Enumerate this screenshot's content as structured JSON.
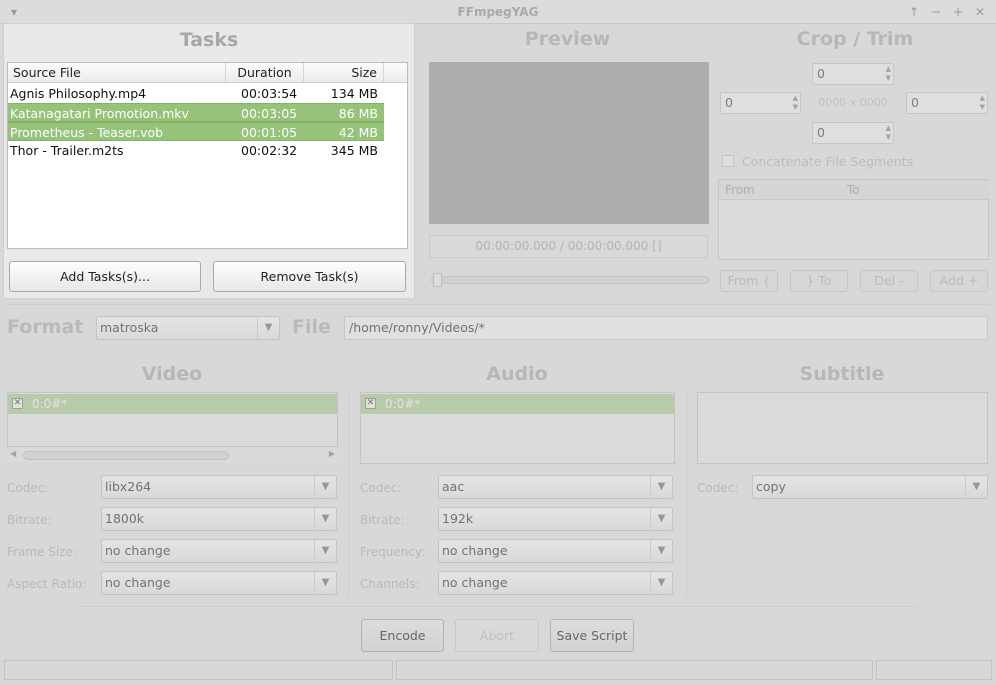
{
  "window": {
    "title": "FFmpegYAG"
  },
  "tasks": {
    "heading": "Tasks",
    "columns": [
      "Source File",
      "Duration",
      "Size"
    ],
    "rows": [
      {
        "file": "Agnis Philosophy.mp4",
        "duration": "00:03:54",
        "size": "134 MB",
        "selected": false
      },
      {
        "file": "Katanagatari Promotion.mkv",
        "duration": "00:03:05",
        "size": "86 MB",
        "selected": true
      },
      {
        "file": "Prometheus - Teaser.vob",
        "duration": "00:01:05",
        "size": "42 MB",
        "selected": true
      },
      {
        "file": "Thor - Trailer.m2ts",
        "duration": "00:02:32",
        "size": "345 MB",
        "selected": false
      }
    ],
    "add_button": "Add Tasks(s)...",
    "remove_button": "Remove Task(s)"
  },
  "preview": {
    "heading": "Preview",
    "timecode": "00:00:00.000 / 00:00:00.000 []"
  },
  "crop": {
    "heading": "Crop / Trim",
    "top": "0",
    "left": "0",
    "right": "0",
    "bottom": "0",
    "size_label": "0000 x 0000",
    "concat_label": "Concatenate File Segments",
    "col_from": "From",
    "col_to": "To",
    "btn_from": "From {",
    "btn_to": "} To",
    "btn_del": "Del -",
    "btn_add": "Add +"
  },
  "format": {
    "label": "Format",
    "value": "matroska",
    "file_label": "File",
    "file_value": "/home/ronny/Videos/*"
  },
  "video": {
    "heading": "Video",
    "stream": "0:0#*",
    "codec_label": "Codec:",
    "codec": "libx264",
    "bitrate_label": "Bitrate:",
    "bitrate": "1800k",
    "framesize_label": "Frame Size:",
    "framesize": "no change",
    "aspect_label": "Aspect Ratio:",
    "aspect": "no change"
  },
  "audio": {
    "heading": "Audio",
    "stream": "0:0#*",
    "codec_label": "Codec:",
    "codec": "aac",
    "bitrate_label": "Bitrate:",
    "bitrate": "192k",
    "frequency_label": "Frequency:",
    "frequency": "no change",
    "channels_label": "Channels:",
    "channels": "no change"
  },
  "subtitle": {
    "heading": "Subtitle",
    "codec_label": "Codec:",
    "codec": "copy"
  },
  "actions": {
    "encode": "Encode",
    "abort": "Abort",
    "save_script": "Save Script"
  },
  "icons": {
    "menu": "chevron-down-icon",
    "up": "arrow-up-icon",
    "minimize": "minimize-icon",
    "maximize": "maximize-icon",
    "close": "close-icon"
  },
  "colors": {
    "selection": "#97c27a",
    "background": "#e2e2e2"
  }
}
